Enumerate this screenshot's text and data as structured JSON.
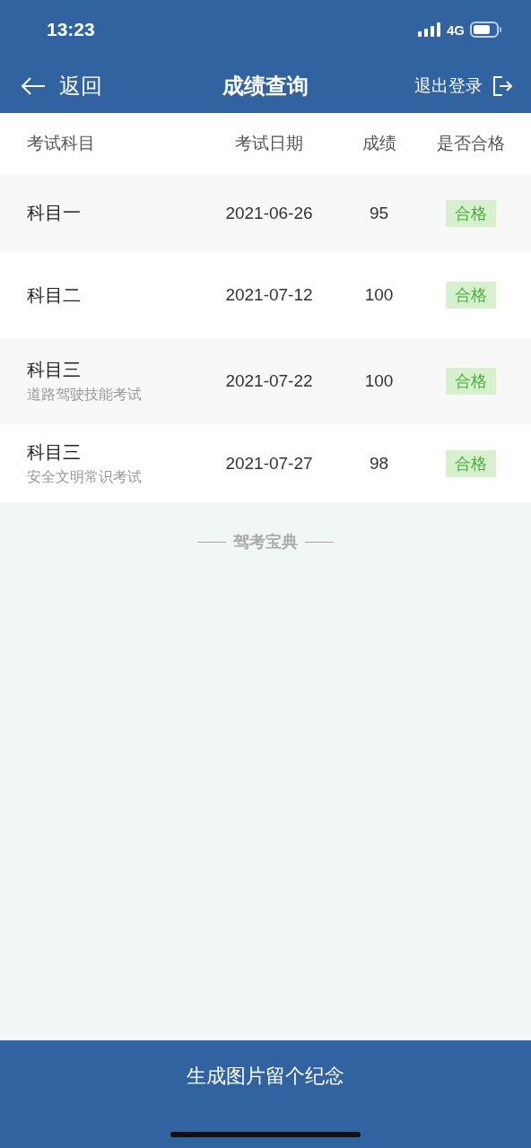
{
  "status_bar": {
    "time": "13:23",
    "network": "4G"
  },
  "nav": {
    "back": "返回",
    "title": "成绩查询",
    "logout": "退出登录"
  },
  "table": {
    "columns": [
      "考试科目",
      "考试日期",
      "成绩",
      "是否合格"
    ],
    "rows": [
      {
        "subject": "科目一",
        "date": "2021-06-26",
        "score": "95",
        "result": "合格",
        "passed": true
      },
      {
        "subject": "科目二",
        "date": "2021-07-12",
        "score": "100",
        "result": "合格",
        "passed": true
      },
      {
        "subject": "科目三",
        "subtitle": "道路驾驶技能考试",
        "date": "2021-07-22",
        "score": "100",
        "result": "合格",
        "passed": true
      },
      {
        "subject": "科目三",
        "subtitle": "安全文明常识考试",
        "date": "2021-07-27",
        "score": "98",
        "result": "合格",
        "passed": true
      }
    ]
  },
  "footer_brand": "驾考宝典",
  "bottom_button": "生成图片留个纪念"
}
